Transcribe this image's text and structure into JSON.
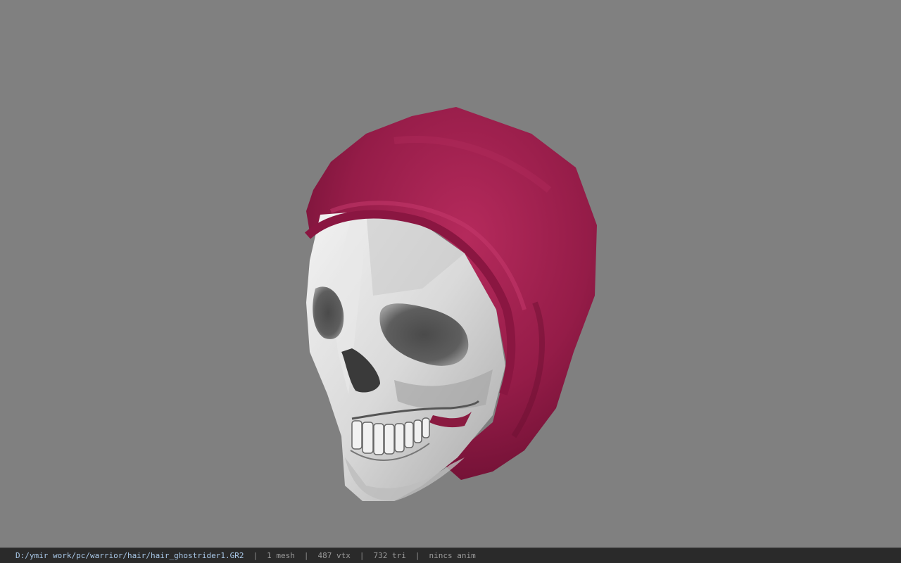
{
  "viewer": {
    "background_color": "#808080",
    "model_icon": "skull-hood-model",
    "hood_color": "#9b1c4c",
    "bone_color": "#d8d8d8"
  },
  "status": {
    "file_path": "D:/ymir work/pc/warrior/hair/hair_ghostrider1.GR2",
    "separator": "|",
    "mesh_count": "1 mesh",
    "vertex_count": "487 vtx",
    "triangle_count": "732 tri",
    "anim_info": "nincs anim"
  }
}
